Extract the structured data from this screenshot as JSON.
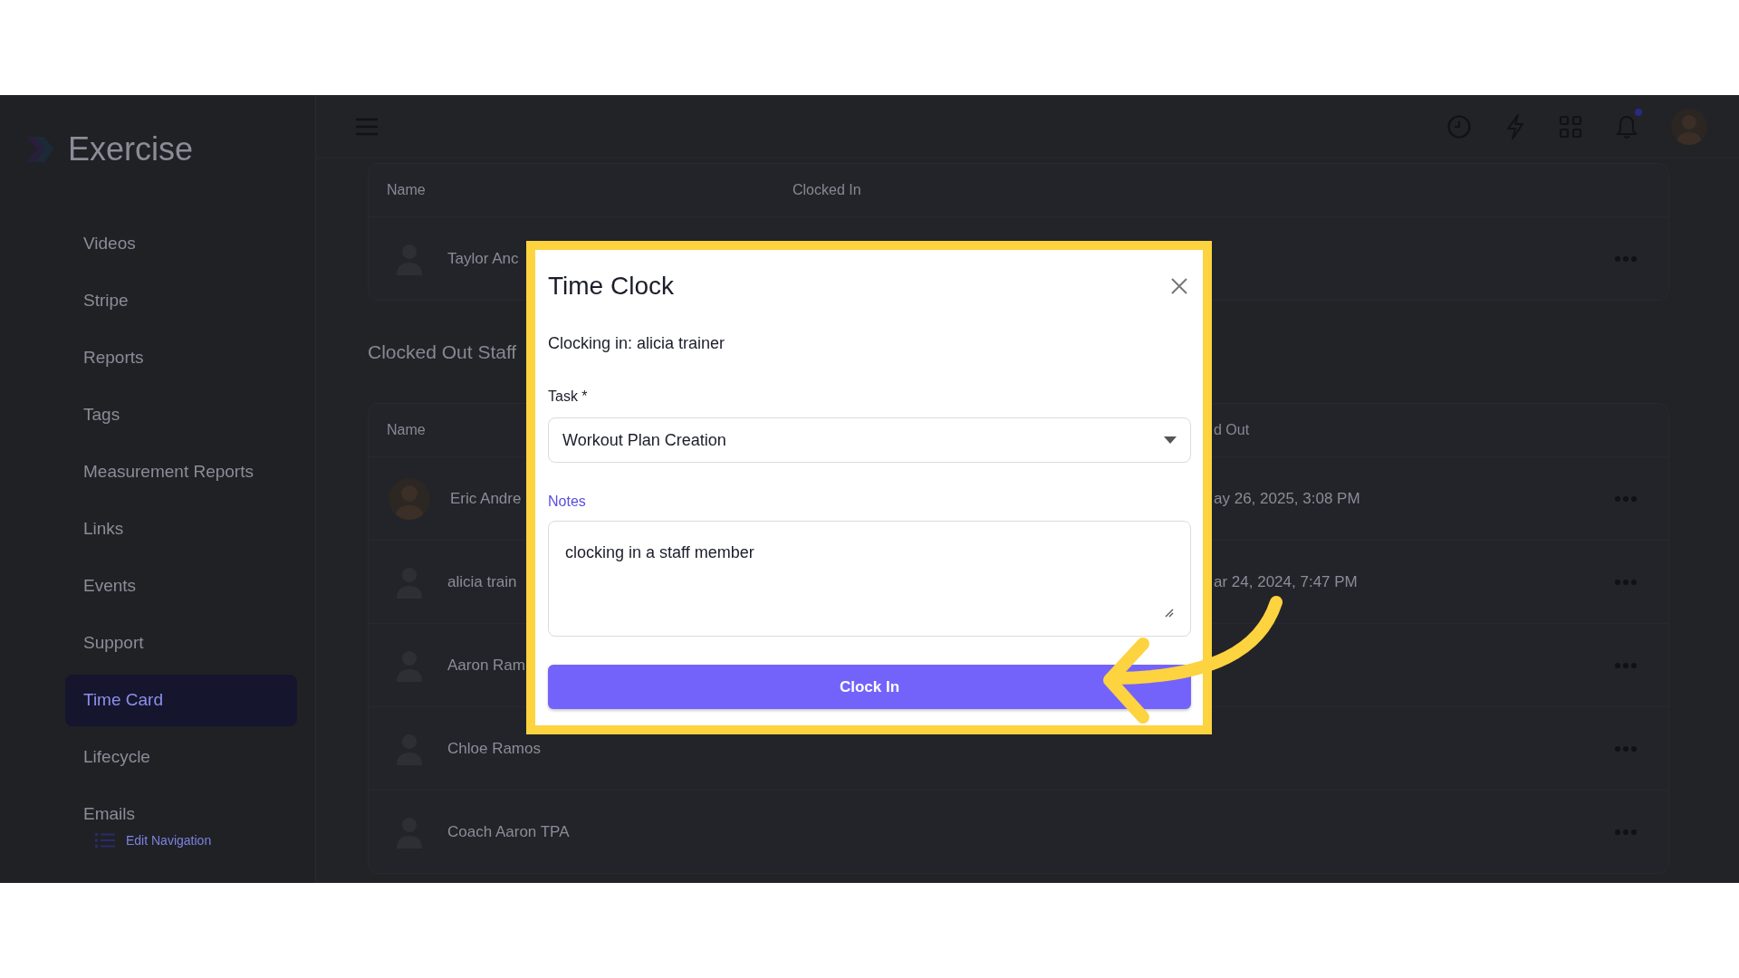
{
  "app": {
    "title": "Exercise"
  },
  "sidebar": {
    "items": [
      {
        "label": "Videos",
        "selected": false
      },
      {
        "label": "Stripe",
        "selected": false
      },
      {
        "label": "Reports",
        "selected": false
      },
      {
        "label": "Tags",
        "selected": false
      },
      {
        "label": "Measurement Reports",
        "selected": false
      },
      {
        "label": "Links",
        "selected": false
      },
      {
        "label": "Events",
        "selected": false
      },
      {
        "label": "Support",
        "selected": false
      },
      {
        "label": "Time Card",
        "selected": true
      },
      {
        "label": "Lifecycle",
        "selected": false
      },
      {
        "label": "Emails",
        "selected": false
      }
    ],
    "edit_navigation": "Edit Navigation"
  },
  "topbar": {
    "notifications": {
      "unread": true
    }
  },
  "clocked_in_table": {
    "columns": [
      "Name",
      "Clocked In"
    ],
    "rows": [
      {
        "name": "Taylor Anc",
        "kind": "placeholder"
      }
    ]
  },
  "clocked_out_section": {
    "heading": "Clocked Out Staff",
    "columns": [
      "Name",
      "d Out"
    ],
    "rows": [
      {
        "name": "Eric Andre",
        "clocked_out": "ay 26, 2025, 3:08 PM",
        "kind": "photo"
      },
      {
        "name": "alicia train",
        "clocked_out": "ar 24, 2024, 7:47 PM",
        "kind": "placeholder"
      },
      {
        "name": "Aaron Ram",
        "kind": "placeholder"
      },
      {
        "name": "Chloe Ramos",
        "kind": "placeholder"
      },
      {
        "name": "Coach Aaron TPA",
        "kind": "placeholder"
      }
    ]
  },
  "modal": {
    "title": "Time Clock",
    "subtitle": "Clocking in: alicia trainer",
    "task": {
      "label": "Task *",
      "value": "Workout Plan Creation"
    },
    "notes": {
      "label": "Notes",
      "value": "clocking in a staff member"
    },
    "button": "Clock In"
  }
}
